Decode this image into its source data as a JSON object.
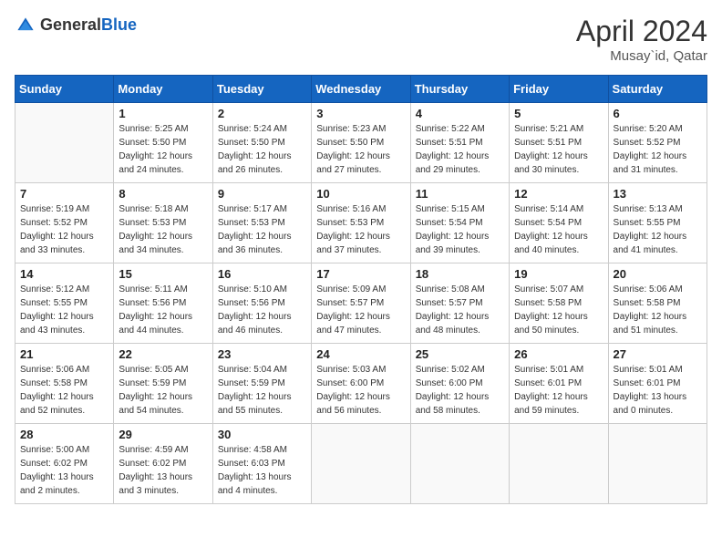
{
  "header": {
    "logo_general": "General",
    "logo_blue": "Blue",
    "title": "April 2024",
    "subtitle": "Musay`id, Qatar"
  },
  "calendar": {
    "days_of_week": [
      "Sunday",
      "Monday",
      "Tuesday",
      "Wednesday",
      "Thursday",
      "Friday",
      "Saturday"
    ],
    "weeks": [
      [
        {
          "day": "",
          "info": ""
        },
        {
          "day": "1",
          "info": "Sunrise: 5:25 AM\nSunset: 5:50 PM\nDaylight: 12 hours\nand 24 minutes."
        },
        {
          "day": "2",
          "info": "Sunrise: 5:24 AM\nSunset: 5:50 PM\nDaylight: 12 hours\nand 26 minutes."
        },
        {
          "day": "3",
          "info": "Sunrise: 5:23 AM\nSunset: 5:50 PM\nDaylight: 12 hours\nand 27 minutes."
        },
        {
          "day": "4",
          "info": "Sunrise: 5:22 AM\nSunset: 5:51 PM\nDaylight: 12 hours\nand 29 minutes."
        },
        {
          "day": "5",
          "info": "Sunrise: 5:21 AM\nSunset: 5:51 PM\nDaylight: 12 hours\nand 30 minutes."
        },
        {
          "day": "6",
          "info": "Sunrise: 5:20 AM\nSunset: 5:52 PM\nDaylight: 12 hours\nand 31 minutes."
        }
      ],
      [
        {
          "day": "7",
          "info": "Sunrise: 5:19 AM\nSunset: 5:52 PM\nDaylight: 12 hours\nand 33 minutes."
        },
        {
          "day": "8",
          "info": "Sunrise: 5:18 AM\nSunset: 5:53 PM\nDaylight: 12 hours\nand 34 minutes."
        },
        {
          "day": "9",
          "info": "Sunrise: 5:17 AM\nSunset: 5:53 PM\nDaylight: 12 hours\nand 36 minutes."
        },
        {
          "day": "10",
          "info": "Sunrise: 5:16 AM\nSunset: 5:53 PM\nDaylight: 12 hours\nand 37 minutes."
        },
        {
          "day": "11",
          "info": "Sunrise: 5:15 AM\nSunset: 5:54 PM\nDaylight: 12 hours\nand 39 minutes."
        },
        {
          "day": "12",
          "info": "Sunrise: 5:14 AM\nSunset: 5:54 PM\nDaylight: 12 hours\nand 40 minutes."
        },
        {
          "day": "13",
          "info": "Sunrise: 5:13 AM\nSunset: 5:55 PM\nDaylight: 12 hours\nand 41 minutes."
        }
      ],
      [
        {
          "day": "14",
          "info": "Sunrise: 5:12 AM\nSunset: 5:55 PM\nDaylight: 12 hours\nand 43 minutes."
        },
        {
          "day": "15",
          "info": "Sunrise: 5:11 AM\nSunset: 5:56 PM\nDaylight: 12 hours\nand 44 minutes."
        },
        {
          "day": "16",
          "info": "Sunrise: 5:10 AM\nSunset: 5:56 PM\nDaylight: 12 hours\nand 46 minutes."
        },
        {
          "day": "17",
          "info": "Sunrise: 5:09 AM\nSunset: 5:57 PM\nDaylight: 12 hours\nand 47 minutes."
        },
        {
          "day": "18",
          "info": "Sunrise: 5:08 AM\nSunset: 5:57 PM\nDaylight: 12 hours\nand 48 minutes."
        },
        {
          "day": "19",
          "info": "Sunrise: 5:07 AM\nSunset: 5:58 PM\nDaylight: 12 hours\nand 50 minutes."
        },
        {
          "day": "20",
          "info": "Sunrise: 5:06 AM\nSunset: 5:58 PM\nDaylight: 12 hours\nand 51 minutes."
        }
      ],
      [
        {
          "day": "21",
          "info": "Sunrise: 5:06 AM\nSunset: 5:58 PM\nDaylight: 12 hours\nand 52 minutes."
        },
        {
          "day": "22",
          "info": "Sunrise: 5:05 AM\nSunset: 5:59 PM\nDaylight: 12 hours\nand 54 minutes."
        },
        {
          "day": "23",
          "info": "Sunrise: 5:04 AM\nSunset: 5:59 PM\nDaylight: 12 hours\nand 55 minutes."
        },
        {
          "day": "24",
          "info": "Sunrise: 5:03 AM\nSunset: 6:00 PM\nDaylight: 12 hours\nand 56 minutes."
        },
        {
          "day": "25",
          "info": "Sunrise: 5:02 AM\nSunset: 6:00 PM\nDaylight: 12 hours\nand 58 minutes."
        },
        {
          "day": "26",
          "info": "Sunrise: 5:01 AM\nSunset: 6:01 PM\nDaylight: 12 hours\nand 59 minutes."
        },
        {
          "day": "27",
          "info": "Sunrise: 5:01 AM\nSunset: 6:01 PM\nDaylight: 13 hours\nand 0 minutes."
        }
      ],
      [
        {
          "day": "28",
          "info": "Sunrise: 5:00 AM\nSunset: 6:02 PM\nDaylight: 13 hours\nand 2 minutes."
        },
        {
          "day": "29",
          "info": "Sunrise: 4:59 AM\nSunset: 6:02 PM\nDaylight: 13 hours\nand 3 minutes."
        },
        {
          "day": "30",
          "info": "Sunrise: 4:58 AM\nSunset: 6:03 PM\nDaylight: 13 hours\nand 4 minutes."
        },
        {
          "day": "",
          "info": ""
        },
        {
          "day": "",
          "info": ""
        },
        {
          "day": "",
          "info": ""
        },
        {
          "day": "",
          "info": ""
        }
      ]
    ]
  }
}
